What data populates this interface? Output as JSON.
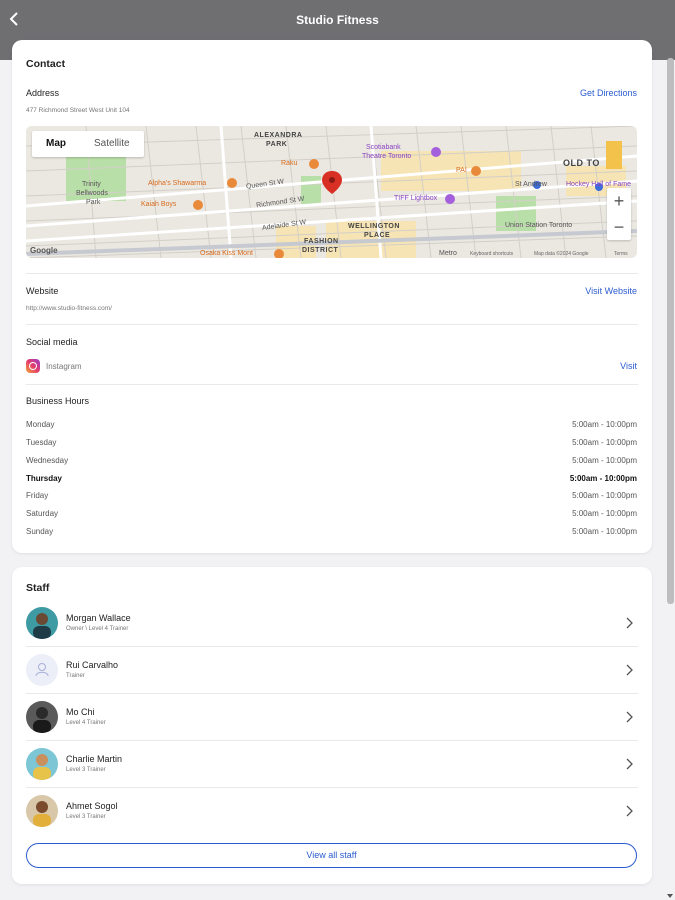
{
  "header": {
    "title": "Studio Fitness"
  },
  "contact": {
    "heading": "Contact",
    "address_label": "Address",
    "address_value": "477 Richmond Street West Unit 104",
    "directions_link": "Get Directions",
    "map": {
      "map_tab": "Map",
      "satellite_tab": "Satellite",
      "zoom_in": "+",
      "zoom_out": "−",
      "labels": {
        "alexandra": "ALEXANDRA",
        "park": "PARK",
        "trinity": "Trinity",
        "bellwoods": "Bellwoods",
        "park2": "Park",
        "fashion": "FASHION",
        "district": "DISTRICT",
        "wellington": "WELLINGTON",
        "place": "PLACE",
        "old_to": "OLD TO",
        "raku": "Raku",
        "scotiabank": "Scotiabank",
        "theatre": "Theatre Toronto",
        "alpha": "Alpha's Shawarma",
        "kaiah": "Kaiah Boys",
        "pai": "PAI",
        "st_andrew": "St Andrew",
        "hockey": "Hockey Hall of Fame",
        "tiff": "TIFF Lightbox",
        "union": "Union Station Toronto",
        "queen": "Queen St W",
        "richmond": "Richmond St W",
        "adelaide": "Adelaide St W",
        "google": "Google",
        "metro": "Metro",
        "keyboard": "Keyboard shortcuts",
        "mapdata": "Map data ©2024 Google",
        "terms": "Terms",
        "osaka": "Osaka Kiss Mont"
      }
    },
    "website_label": "Website",
    "website_value": "http://www.studio-fitness.com/",
    "website_link": "Visit Website",
    "social_label": "Social media",
    "social_name": "Instagram",
    "social_link": "Visit",
    "hours_label": "Business Hours",
    "hours": [
      {
        "day": "Monday",
        "time": "5:00am - 10:00pm",
        "today": false
      },
      {
        "day": "Tuesday",
        "time": "5:00am - 10:00pm",
        "today": false
      },
      {
        "day": "Wednesday",
        "time": "5:00am - 10:00pm",
        "today": false
      },
      {
        "day": "Thursday",
        "time": "5:00am - 10:00pm",
        "today": true
      },
      {
        "day": "Friday",
        "time": "5:00am - 10:00pm",
        "today": false
      },
      {
        "day": "Saturday",
        "time": "5:00am - 10:00pm",
        "today": false
      },
      {
        "day": "Sunday",
        "time": "5:00am - 10:00pm",
        "today": false
      }
    ]
  },
  "staff": {
    "heading": "Staff",
    "members": [
      {
        "name": "Morgan Wallace",
        "role": "Owner \\ Level 4 Trainer"
      },
      {
        "name": "Rui Carvalho",
        "role": "Trainer"
      },
      {
        "name": "Mo Chi",
        "role": "Level 4 Trainer"
      },
      {
        "name": "Charlie Martin",
        "role": "Level 3 Trainer"
      },
      {
        "name": "Ahmet Sogol",
        "role": "Level 3 Trainer"
      }
    ],
    "view_all": "View all staff"
  },
  "colors": {
    "accent": "#2b5ccf",
    "header_bg": "#6f6f72",
    "page_bg": "#f2f2f4"
  }
}
